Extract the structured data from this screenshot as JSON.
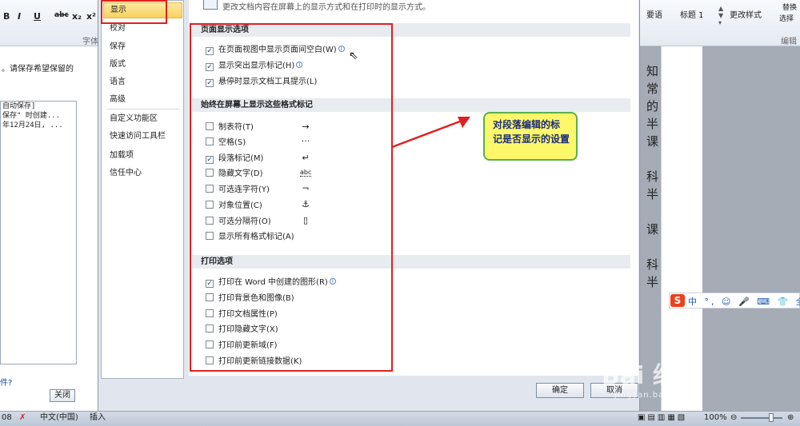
{
  "background_window": {
    "format_buttons": [
      "B",
      "I",
      "U",
      "abc",
      "x₂",
      "x²"
    ],
    "ribbon_group_left": "字体",
    "autosave_hint": "。请保存希望保留的",
    "autosave_list": [
      "自动保存]",
      "保存\" 时创建...",
      "年12月24日, ..."
    ],
    "left_footer_link": "件?",
    "close_label": "关闭",
    "ribbon_right": {
      "style_1": "要语",
      "style_2": "标题 1",
      "change_styles": "更改样式",
      "replace": "替换",
      "select": "选择",
      "group_editing": "编辑"
    },
    "doc_chars": [
      "知",
      "常",
      "的",
      "半",
      "课",
      "",
      "科",
      "半",
      "",
      "课",
      "",
      "科",
      "半"
    ]
  },
  "dialog": {
    "top_description": "更改文档内容在屏幕上的显示方式和在打印时的显示方式。",
    "nav": [
      "显示",
      "校对",
      "保存",
      "版式",
      "语言",
      "高级",
      "自定义功能区",
      "快速访问工具栏",
      "加载项",
      "信任中心"
    ],
    "sections": {
      "page_display": {
        "title": "页面显示选项",
        "options": [
          {
            "label": "在页面视图中显示页面间空白(W)",
            "checked": "✓",
            "info": "i"
          },
          {
            "label": "显示突出显示标记(H)",
            "checked": "✓",
            "info": "i"
          },
          {
            "label": "悬停时显示文档工具提示(L)",
            "checked": "✓"
          }
        ]
      },
      "formatting_marks": {
        "title": "始终在屏幕上显示这些格式标记",
        "options": [
          {
            "label": "制表符(T)",
            "checked": "",
            "symbol": "→"
          },
          {
            "label": "空格(S)",
            "checked": "",
            "symbol": "···"
          },
          {
            "label": "段落标记(M)",
            "checked": "✓",
            "symbol": "↵"
          },
          {
            "label": "隐藏文字(D)",
            "checked": "",
            "symbol": "abc"
          },
          {
            "label": "可选连字符(Y)",
            "checked": "",
            "symbol": "¬"
          },
          {
            "label": "对象位置(C)",
            "checked": "",
            "symbol": "⚓"
          },
          {
            "label": "可选分隔符(O)",
            "checked": "",
            "symbol": "▯"
          },
          {
            "label": "显示所有格式标记(A)",
            "checked": ""
          }
        ]
      },
      "print": {
        "title": "打印选项",
        "options": [
          {
            "label": "打印在 Word 中创建的图形(R)",
            "checked": "✓",
            "info": "i"
          },
          {
            "label": "打印背景色和图像(B)",
            "checked": ""
          },
          {
            "label": "打印文档属性(P)",
            "checked": ""
          },
          {
            "label": "打印隐藏文字(X)",
            "checked": ""
          },
          {
            "label": "打印前更新域(F)",
            "checked": ""
          },
          {
            "label": "打印前更新链接数据(K)",
            "checked": ""
          }
        ]
      }
    },
    "ok_label": "确定",
    "cancel_label": "取消"
  },
  "annotation": {
    "callout_line1": "对段落编辑的标",
    "callout_line2": "记是否显示的设置",
    "colors": {
      "box": "#e02020",
      "callout_fill": "#fdf86a",
      "callout_border": "#5ab04c"
    }
  },
  "status_bar": {
    "page_num": "08",
    "language": "中文(中国)",
    "insert_mode": "插入",
    "zoom": "100%"
  },
  "ime_bar": {
    "logo": "S",
    "items": "中 °, ☺ 🎤 ⌨ 👕 全"
  },
  "watermark": {
    "main": "Bai 经验",
    "sub": "jingyan.baidu.com"
  }
}
